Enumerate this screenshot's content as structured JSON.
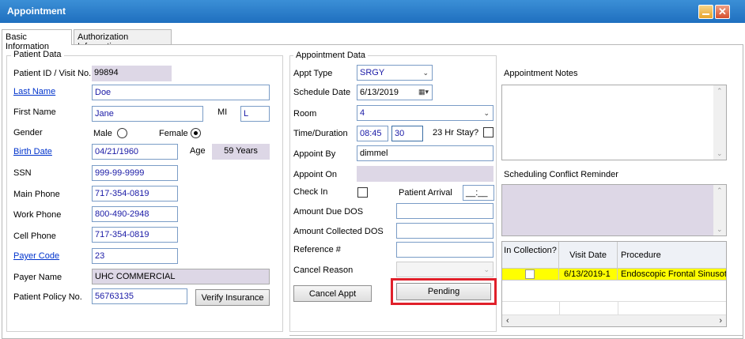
{
  "window": {
    "title": "Appointment"
  },
  "tabs": [
    "Basic Information",
    "Authorization Information"
  ],
  "patient": {
    "group_title": "Patient Data",
    "labels": {
      "patient_id": "Patient ID / Visit No.",
      "last_name": "Last Name",
      "first_name": "First Name",
      "mi": "MI",
      "gender": "Gender",
      "male": "Male",
      "female": "Female",
      "birth_date": "Birth Date",
      "age": "Age",
      "ssn": "SSN",
      "main_phone": "Main Phone",
      "work_phone": "Work Phone",
      "cell_phone": "Cell Phone",
      "payer_code": "Payer Code",
      "payer_name": "Payer Name",
      "policy_no": "Patient Policy No."
    },
    "values": {
      "patient_id": "99894",
      "last_name": "Doe",
      "first_name": "Jane",
      "mi": "L",
      "gender": "Female",
      "birth_date": "04/21/1960",
      "age": "59 Years",
      "ssn": "999-99-9999",
      "main_phone": "717-354-0819",
      "work_phone": "800-490-2948",
      "cell_phone": "717-354-0819",
      "payer_code": "23",
      "payer_name": "UHC COMMERCIAL",
      "policy_no": "56763135"
    },
    "verify_button": "Verify Insurance"
  },
  "appointment": {
    "group_title": "Appointment Data",
    "labels": {
      "appt_type": "Appt Type",
      "schedule_date": "Schedule Date",
      "room": "Room",
      "time_duration": "Time/Duration",
      "stay": "23 Hr Stay?",
      "appoint_by": "Appoint By",
      "appoint_on": "Appoint On",
      "check_in": "Check In",
      "patient_arrival": "Patient Arrival",
      "amount_due": "Amount Due DOS",
      "amount_collected": "Amount Collected DOS",
      "reference": "Reference #",
      "cancel_reason": "Cancel Reason"
    },
    "values": {
      "appt_type": "SRGY",
      "schedule_date": "6/13/2019",
      "room": "4",
      "time": "08:45",
      "duration": "30",
      "appoint_by": "dimmel",
      "patient_arrival": "__:__"
    },
    "cancel_button": "Cancel Appt",
    "pending_button": "Pending"
  },
  "notes": {
    "appointment_notes_label": "Appointment Notes",
    "conflict_label": "Scheduling Conflict Reminder"
  },
  "visits_grid": {
    "headers": [
      "In Collection?",
      "Visit Date",
      "Procedure"
    ],
    "rows": [
      {
        "visit_date": "6/13/2019-1",
        "procedure": "Endoscopic Frontal Sinusoto"
      }
    ]
  },
  "colors": {
    "highlight": "#e0202a",
    "row_highlight": "#ffff00",
    "readonly": "#ddd7e6"
  }
}
